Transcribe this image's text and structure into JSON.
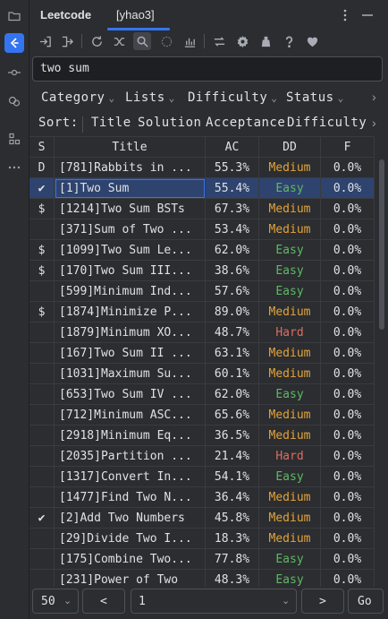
{
  "sidebar": {
    "icons": [
      "folder-icon",
      "leetcode-icon",
      "commit-icon",
      "plugin-icon",
      "structure-icon",
      "more-icon"
    ]
  },
  "header": {
    "tabs": [
      {
        "label": "Leetcode"
      },
      {
        "label": "[yhao3]"
      }
    ]
  },
  "toolbar": {
    "buttons": [
      "login-icon",
      "logout-icon",
      "refresh-icon",
      "shuffle-icon",
      "search-icon",
      "loading-icon",
      "chart-icon",
      "switch-icon",
      "settings-icon",
      "clear-icon",
      "help-icon",
      "heart-icon"
    ]
  },
  "search": {
    "value": "two sum"
  },
  "filters": {
    "items": [
      "Category",
      "Lists",
      "Difficulty",
      "Status"
    ]
  },
  "sort": {
    "label": "Sort:",
    "items": [
      "Title",
      "Solution",
      "Acceptance",
      "Difficulty"
    ]
  },
  "table": {
    "columns": [
      "S",
      "Title",
      "AC",
      "DD",
      "F"
    ],
    "rows": [
      {
        "s": "D",
        "title": "[781]Rabbits in ...",
        "ac": "55.3%",
        "dd": "Medium",
        "f": "0.0%"
      },
      {
        "s": "✔",
        "title": "[1]Two Sum",
        "ac": "55.4%",
        "dd": "Easy",
        "f": "0.0%",
        "selected": true
      },
      {
        "s": "$",
        "title": "[1214]Two Sum BSTs",
        "ac": "67.3%",
        "dd": "Medium",
        "f": "0.0%"
      },
      {
        "s": "",
        "title": "[371]Sum of Two ...",
        "ac": "53.4%",
        "dd": "Medium",
        "f": "0.0%"
      },
      {
        "s": "$",
        "title": "[1099]Two Sum Le...",
        "ac": "62.0%",
        "dd": "Easy",
        "f": "0.0%"
      },
      {
        "s": "$",
        "title": "[170]Two Sum III...",
        "ac": "38.6%",
        "dd": "Easy",
        "f": "0.0%"
      },
      {
        "s": "",
        "title": "[599]Minimum Ind...",
        "ac": "57.6%",
        "dd": "Easy",
        "f": "0.0%"
      },
      {
        "s": "$",
        "title": "[1874]Minimize P...",
        "ac": "89.0%",
        "dd": "Medium",
        "f": "0.0%"
      },
      {
        "s": "",
        "title": "[1879]Minimum XO...",
        "ac": "48.7%",
        "dd": "Hard",
        "f": "0.0%"
      },
      {
        "s": "",
        "title": "[167]Two Sum II ...",
        "ac": "63.1%",
        "dd": "Medium",
        "f": "0.0%"
      },
      {
        "s": "",
        "title": "[1031]Maximum Su...",
        "ac": "60.1%",
        "dd": "Medium",
        "f": "0.0%"
      },
      {
        "s": "",
        "title": "[653]Two Sum IV ...",
        "ac": "62.0%",
        "dd": "Easy",
        "f": "0.0%"
      },
      {
        "s": "",
        "title": "[712]Minimum ASC...",
        "ac": "65.6%",
        "dd": "Medium",
        "f": "0.0%"
      },
      {
        "s": "",
        "title": "[2918]Minimum Eq...",
        "ac": "36.5%",
        "dd": "Medium",
        "f": "0.0%"
      },
      {
        "s": "",
        "title": "[2035]Partition ...",
        "ac": "21.4%",
        "dd": "Hard",
        "f": "0.0%"
      },
      {
        "s": "",
        "title": "[1317]Convert In...",
        "ac": "54.1%",
        "dd": "Easy",
        "f": "0.0%"
      },
      {
        "s": "",
        "title": "[1477]Find Two N...",
        "ac": "36.4%",
        "dd": "Medium",
        "f": "0.0%"
      },
      {
        "s": "✔",
        "title": "[2]Add Two Numbers",
        "ac": "45.8%",
        "dd": "Medium",
        "f": "0.0%"
      },
      {
        "s": "",
        "title": "[29]Divide Two I...",
        "ac": "18.3%",
        "dd": "Medium",
        "f": "0.0%"
      },
      {
        "s": "",
        "title": "[175]Combine Two...",
        "ac": "77.8%",
        "dd": "Easy",
        "f": "0.0%"
      },
      {
        "s": "",
        "title": "[231]Power of Two",
        "ac": "48.3%",
        "dd": "Easy",
        "f": "0.0%"
      }
    ]
  },
  "pager": {
    "page_size": "50",
    "prev": "<",
    "page": "1",
    "next": ">",
    "go": "Go"
  },
  "colors": {
    "accent": "#3574f0",
    "easy": "#5fb865",
    "medium": "#e5a33a",
    "hard": "#e06c62"
  }
}
